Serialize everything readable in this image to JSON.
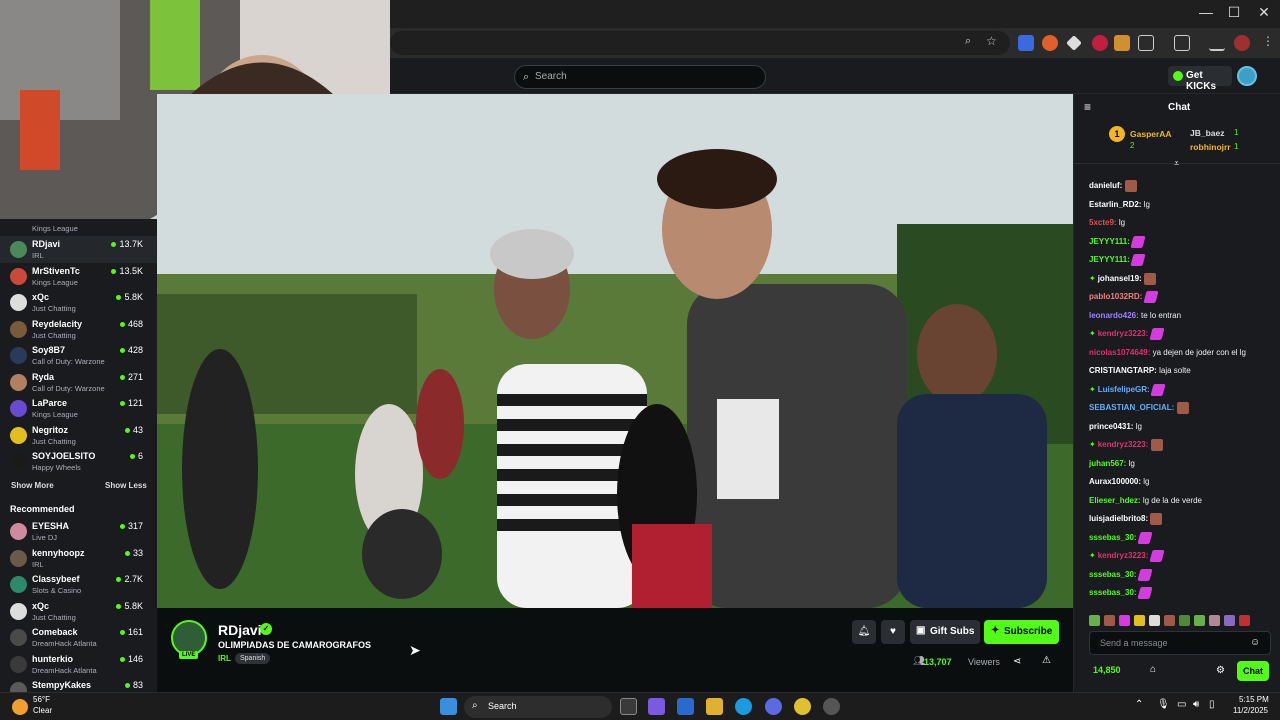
{
  "browser": {
    "window_controls": {
      "minimize": "—",
      "maximize": "☐",
      "close": "✕"
    }
  },
  "topbar": {
    "search_placeholder": "Search",
    "get_kicks_label": "Get KICKs"
  },
  "sidebar": {
    "partial_top": {
      "category": "Kings League"
    },
    "following": [
      {
        "name": "RDjavi",
        "category": "IRL",
        "viewers": "13.7K",
        "color": "#4a8a5a",
        "active": true
      },
      {
        "name": "MrStivenTc",
        "category": "Kings League",
        "viewers": "13.5K",
        "color": "#c94a3a"
      },
      {
        "name": "xQc",
        "category": "Just Chatting",
        "viewers": "5.8K",
        "color": "#dddddd"
      },
      {
        "name": "Reydelacity",
        "category": "Just Chatting",
        "viewers": "468",
        "color": "#7a5a3a"
      },
      {
        "name": "Soy8B7",
        "category": "Call of Duty: Warzone",
        "viewers": "428",
        "color": "#2a3a5a"
      },
      {
        "name": "Ryda",
        "category": "Call of Duty: Warzone",
        "viewers": "271",
        "color": "#b08060"
      },
      {
        "name": "LaParce",
        "category": "Kings League",
        "viewers": "121",
        "color": "#6a4ad0"
      },
      {
        "name": "Negritoz",
        "category": "Just Chatting",
        "viewers": "43",
        "color": "#e0c020"
      },
      {
        "name": "SOYJOELSITO",
        "category": "Happy Wheels",
        "viewers": "6",
        "color": "#1a1a1a"
      }
    ],
    "show_more": "Show More",
    "show_less": "Show Less",
    "recommended_title": "Recommended",
    "recommended": [
      {
        "name": "EYESHA",
        "category": "Live DJ",
        "viewers": "317",
        "color": "#d08aa0"
      },
      {
        "name": "kennyhoopz",
        "category": "IRL",
        "viewers": "33",
        "color": "#6a5a4a"
      },
      {
        "name": "Classybeef",
        "category": "Slots & Casino",
        "viewers": "2.7K",
        "color": "#2a8a6a"
      },
      {
        "name": "xQc",
        "category": "Just Chatting",
        "viewers": "5.8K",
        "color": "#dddddd"
      },
      {
        "name": "Comeback",
        "category": "DreamHack Atlanta",
        "viewers": "161",
        "color": "#4a4a4a"
      },
      {
        "name": "hunterkio",
        "category": "DreamHack Atlanta",
        "viewers": "146",
        "color": "#3a3a3a"
      },
      {
        "name": "StempyKakes",
        "category": "",
        "viewers": "83",
        "color": "#5a5a5a"
      }
    ]
  },
  "stream": {
    "channel_name": "RDjavi",
    "live_label": "LIVE",
    "title": "OLIMPIADAS DE CAMAROGRAFOS",
    "category": "IRL",
    "language_tag": "Spanish",
    "gift_subs_label": "Gift Subs",
    "subscribe_label": "Subscribe",
    "viewers_count": "13,707",
    "viewers_label": "Viewers"
  },
  "chat": {
    "title": "Chat",
    "leaderboard": [
      {
        "name": "GasperAA",
        "count": "2"
      },
      {
        "name": "JB_baez",
        "count": "1"
      },
      {
        "name": "robhinojrr",
        "count": "1"
      }
    ],
    "messages": [
      {
        "user": "danieluf:",
        "text": "",
        "color": "#ffffff",
        "emote": "face"
      },
      {
        "user": "Estarlin_RD2:",
        "text": "lg",
        "color": "#ffffff",
        "emote": ""
      },
      {
        "user": "5xcte9:",
        "text": "lg",
        "color": "#e05050",
        "emote": ""
      },
      {
        "user": "JEYYY111:",
        "text": "",
        "color": "#53fc18",
        "emote": "pink"
      },
      {
        "user": "JEYYY111:",
        "text": "",
        "color": "#53fc18",
        "emote": "pink"
      },
      {
        "user": "johansel19:",
        "text": "",
        "color": "#ffffff",
        "emote": "face",
        "badge": true
      },
      {
        "user": "pablo1032RD:",
        "text": "",
        "color": "#f08080",
        "emote": "pink"
      },
      {
        "user": "leonardo426:",
        "text": "te lo entran",
        "color": "#a080ff",
        "emote": ""
      },
      {
        "user": "kendryz3223:",
        "text": "",
        "color": "#e03070",
        "emote": "pink",
        "badge": true
      },
      {
        "user": "nicolas1074649:",
        "text": "ya dejen de joder con el lg",
        "color": "#e03070",
        "emote": ""
      },
      {
        "user": "CRISTIANGTARP:",
        "text": "laja solte",
        "color": "#ffffff",
        "emote": ""
      },
      {
        "user": "LuisfelipeGR:",
        "text": "",
        "color": "#60b0ff",
        "emote": "pink",
        "badge": true
      },
      {
        "user": "SEBASTIAN_OFICIAL:",
        "text": "",
        "color": "#60b0ff",
        "emote": "face"
      },
      {
        "user": "prince0431:",
        "text": "lg",
        "color": "#ffffff",
        "emote": ""
      },
      {
        "user": "kendryz3223:",
        "text": "",
        "color": "#e03070",
        "emote": "face",
        "badge": true
      },
      {
        "user": "juhan567:",
        "text": "lg",
        "color": "#53fc18",
        "emote": ""
      },
      {
        "user": "Aurax100000:",
        "text": "lg",
        "color": "#ffffff",
        "emote": ""
      },
      {
        "user": "Elieser_hdez:",
        "text": "lg de la de verde",
        "color": "#53fc18",
        "emote": ""
      },
      {
        "user": "luisjadielbrito8:",
        "text": "",
        "color": "#ffffff",
        "emote": "face"
      },
      {
        "user": "sssebas_30:",
        "text": "",
        "color": "#53fc18",
        "emote": "pink"
      },
      {
        "user": "kendryz3223:",
        "text": "",
        "color": "#e03070",
        "emote": "pink",
        "badge": true
      },
      {
        "user": "sssebas_30:",
        "text": "",
        "color": "#53fc18",
        "emote": "pink"
      },
      {
        "user": "sssebas_30:",
        "text": "",
        "color": "#53fc18",
        "emote": "pink"
      }
    ],
    "input_placeholder": "Send a message",
    "kicks_count": "14,850",
    "chat_button_label": "Chat"
  },
  "taskbar": {
    "weather_temp": "56°F",
    "weather_cond": "Clear",
    "search_label": "Search",
    "time": "5:15 PM",
    "date": "11/2/2025"
  },
  "colors": {
    "accent": "#53fc18",
    "panel": "#191b1f",
    "background": "#0b0e0f"
  }
}
